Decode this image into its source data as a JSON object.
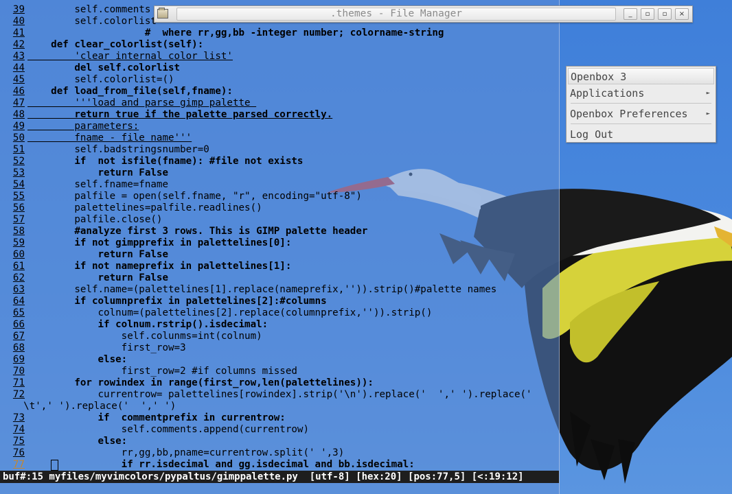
{
  "file_manager": {
    "title": ".themes - File Manager",
    "minimize_label": "_",
    "restore_label": "▫",
    "maximize_label": "▫",
    "close_label": "×"
  },
  "openbox_menu": {
    "title": "Openbox 3",
    "items": [
      {
        "label": "Applications",
        "submenu_arrow": "►"
      },
      {
        "label": "Openbox Preferences",
        "submenu_arrow": "►"
      },
      {
        "label": "Log Out"
      }
    ]
  },
  "vim": {
    "lines": [
      {
        "num": "39",
        "text": "        self.comments"
      },
      {
        "num": "40",
        "text": "        self.colorlist"
      },
      {
        "num": "41",
        "text": "                    #  where rr,gg,bb -integer number; colorname-string"
      },
      {
        "num": "42",
        "text": "    def clear_colorlist(self):"
      },
      {
        "num": "43",
        "text": "        'clear internal color list'"
      },
      {
        "num": "44",
        "text": "        del self.colorlist"
      },
      {
        "num": "45",
        "text": "        self.colorlist=()"
      },
      {
        "num": "46",
        "text": "    def load_from_file(self,fname):"
      },
      {
        "num": "47",
        "text": "        '''load and parse gimp palette "
      },
      {
        "num": "48",
        "text": "        return true if the palette parsed correctly."
      },
      {
        "num": "49",
        "text": "        parameters:"
      },
      {
        "num": "50",
        "text": "        fname - file name'''"
      },
      {
        "num": "51",
        "text": "        self.badstringsnumber=0"
      },
      {
        "num": "52",
        "text": "        if  not isfile(fname): #file not exists"
      },
      {
        "num": "53",
        "text": "            return False"
      },
      {
        "num": "54",
        "text": "        self.fname=fname"
      },
      {
        "num": "55",
        "text": "        palfile = open(self.fname, \"r\", encoding=\"utf-8\")"
      },
      {
        "num": "56",
        "text": "        palettelines=palfile.readlines()"
      },
      {
        "num": "57",
        "text": "        palfile.close()"
      },
      {
        "num": "58",
        "text": "        #analyze first 3 rows. This is GIMP palette header"
      },
      {
        "num": "59",
        "text": "        if not gimpprefix in palettelines[0]:"
      },
      {
        "num": "60",
        "text": "            return False"
      },
      {
        "num": "61",
        "text": "        if not nameprefix in palettelines[1]:"
      },
      {
        "num": "62",
        "text": "            return False"
      },
      {
        "num": "63",
        "text": "        self.name=(palettelines[1].replace(nameprefix,'')).strip()#palette names"
      },
      {
        "num": "64",
        "text": "        if columnprefix in palettelines[2]:#columns"
      },
      {
        "num": "65",
        "text": "            colnum=(palettelines[2].replace(columnprefix,'')).strip()"
      },
      {
        "num": "66",
        "text": "            if colnum.rstrip().isdecimal:"
      },
      {
        "num": "67",
        "text": "                self.colunms=int(colnum)"
      },
      {
        "num": "68",
        "text": "                first_row=3"
      },
      {
        "num": "69",
        "text": "            else:"
      },
      {
        "num": "70",
        "text": "                first_row=2 #if columns missed"
      },
      {
        "num": "71",
        "text": "        for rowindex in range(first_row,len(palettelines)):"
      },
      {
        "num": "72",
        "text": "            currentrow= palettelines[rowindex].strip('\\n').replace('  ',' ').replace('"
      },
      {
        "num": "",
        "text": "    \\t',' ').replace('  ',' ')"
      },
      {
        "num": "73",
        "text": "            if  commentprefix in currentrow:"
      },
      {
        "num": "74",
        "text": "                self.comments.append(currentrow)"
      },
      {
        "num": "75",
        "text": "            else:"
      },
      {
        "num": "76",
        "text": "                rr,gg,bb,pname=currentrow.split(' ',3)"
      },
      {
        "num": "77",
        "text": "                if rr.isdecimal and gg.isdecimal and bb.isdecimal:"
      }
    ],
    "status_line": "buf#:15 myfiles/myvimcolors/pypaltus/gimppalette.py  [utf-8] [hex:20] [pos:77,5] [<:19:12]"
  },
  "colors": {
    "sky": "#4a89de",
    "statusbar_bg": "#1e1e1e",
    "current_line_number": "#c5862d",
    "menu_bg": "#ececec"
  }
}
